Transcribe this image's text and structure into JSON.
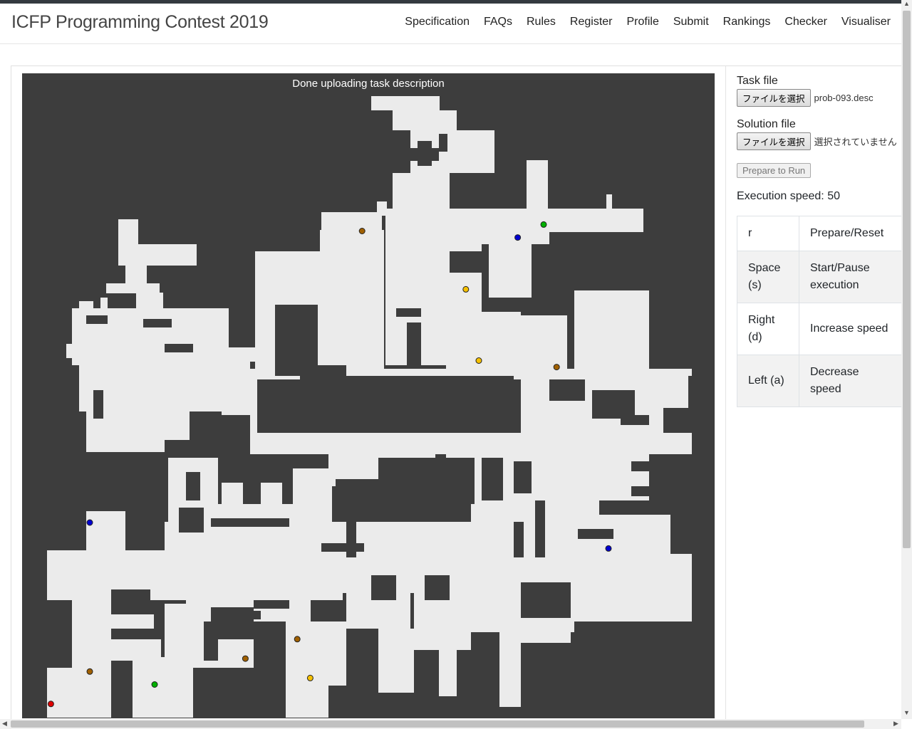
{
  "brand": "ICFP Programming Contest 2019",
  "nav": [
    "Specification",
    "FAQs",
    "Rules",
    "Register",
    "Profile",
    "Submit",
    "Rankings",
    "Checker",
    "Visualiser"
  ],
  "status": "Done uploading task description",
  "task_file": {
    "label": "Task file",
    "button": "ファイルを選択",
    "filename": "prob-093.desc"
  },
  "solution_file": {
    "label": "Solution file",
    "button": "ファイルを選択",
    "filename": "選択されていません"
  },
  "prepare_button": "Prepare to Run",
  "speed": "Execution speed: 50",
  "keys": [
    {
      "key": "r",
      "action": "Prepare/Reset"
    },
    {
      "key": "Space (s)",
      "action": "Start/Pause execution"
    },
    {
      "key": "Right (d)",
      "action": "Increase speed"
    },
    {
      "key": "Left (a)",
      "action": "Decrease speed"
    }
  ],
  "colors": {
    "wall": "#3d3d3d",
    "floor": "#ebebeb",
    "robot": "#e00000",
    "booster_B": "#0000d0",
    "booster_F": "#00b000",
    "booster_L": "#f5c000",
    "booster_R": "#a06000"
  },
  "boosters": [
    {
      "type": "robot",
      "x": 2,
      "y": 2
    },
    {
      "type": "booster_F",
      "x": 10,
      "y": 5
    },
    {
      "type": "booster_R",
      "x": 5,
      "y": 7
    },
    {
      "type": "booster_B",
      "x": 5,
      "y": 30
    },
    {
      "type": "booster_R",
      "x": 17,
      "y": 9
    },
    {
      "type": "booster_R",
      "x": 21,
      "y": 12
    },
    {
      "type": "booster_L",
      "x": 22,
      "y": 6
    },
    {
      "type": "booster_B",
      "x": 45,
      "y": 26
    },
    {
      "type": "booster_R",
      "x": 26,
      "y": 75
    },
    {
      "type": "booster_L",
      "x": 35,
      "y": 55
    },
    {
      "type": "booster_L",
      "x": 34,
      "y": 66
    },
    {
      "type": "booster_B",
      "x": 38,
      "y": 74
    },
    {
      "type": "booster_F",
      "x": 40,
      "y": 76
    },
    {
      "type": "booster_R",
      "x": 41,
      "y": 54
    }
  ]
}
